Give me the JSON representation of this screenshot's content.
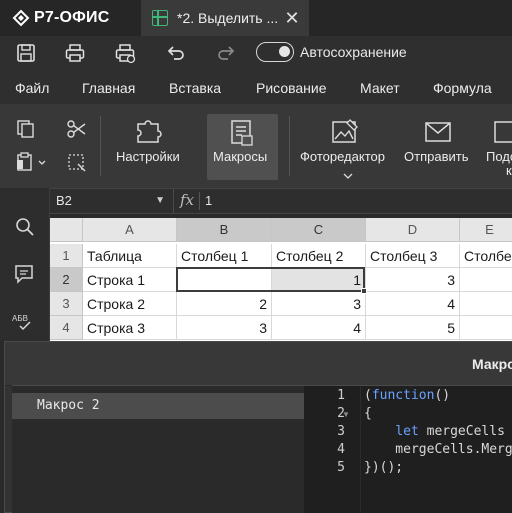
{
  "app": {
    "logo_text": "Р7-ОФИС",
    "document_tab_title": "*2. Выделить ...",
    "colors": {
      "accent_sheet": "#3fb67a",
      "titlebar": "#262626",
      "ribbon": "#383838",
      "keyword": "#6aa2ff"
    }
  },
  "quick_access": {
    "icons": [
      "save-icon",
      "print-icon",
      "quick-print-icon",
      "undo-icon",
      "redo-icon"
    ],
    "autosave_label": "Автосохранение",
    "autosave_on": true
  },
  "menu": {
    "tabs": [
      "Файл",
      "Главная",
      "Вставка",
      "Рисование",
      "Макет",
      "Формула"
    ]
  },
  "ribbon": {
    "settings_label": "Настройки",
    "macros_label": "Макросы",
    "photo_editor_label": "Фоторедактор",
    "send_label": "Отправить",
    "next_label_line1": "Подс",
    "next_label_line2": "к"
  },
  "formula_bar": {
    "cell_ref": "B2",
    "fx_label": "fx",
    "value": "1"
  },
  "sheet": {
    "columns": [
      "A",
      "B",
      "C",
      "D",
      "E"
    ],
    "rows": [
      {
        "num": "1",
        "cells": [
          "Таблица",
          "Столбец 1",
          "Столбец 2",
          "Столбец 3",
          "Столбе"
        ]
      },
      {
        "num": "2",
        "cells": [
          "Строка 1",
          "",
          "1",
          "3",
          ""
        ]
      },
      {
        "num": "3",
        "cells": [
          "Строка 2",
          "2",
          "3",
          "4",
          ""
        ]
      },
      {
        "num": "4",
        "cells": [
          "Строка 3",
          "3",
          "4",
          "5",
          ""
        ]
      }
    ]
  },
  "macro_dialog": {
    "title": "Макро",
    "macros": [
      "Макрос 2"
    ],
    "code": {
      "line_numbers": [
        "1",
        "2",
        "3",
        "4",
        "5"
      ],
      "lines": [
        "(function()",
        "{",
        "    let mergeCells",
        "    mergeCells.Merg",
        "})();"
      ]
    }
  }
}
